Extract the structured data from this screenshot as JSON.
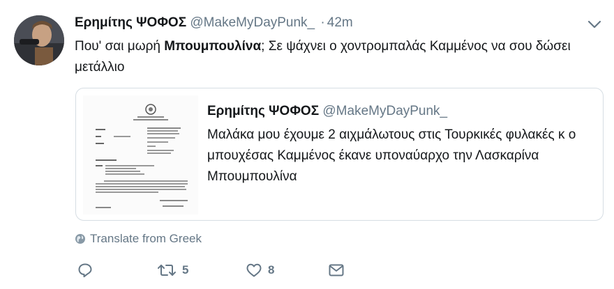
{
  "tweet": {
    "author_name": "Ερημίτης ΨΟΦΟΣ",
    "author_handle": "@MakeMyDayPunk_",
    "separator": "·",
    "time": "42m",
    "text_before": "Που' σαι μωρή ",
    "text_bold": "Μπουμπουλίνα",
    "text_after": "; Σε ψάχνει ο χοντρομπαλάς Καμμένος να σου δώσει μετάλλιο"
  },
  "quoted_tweet": {
    "author_name": "Ερημίτης ΨΟΦΟΣ",
    "author_handle": "@MakeMyDayPunk_",
    "text": "Μαλάκα μου έχουμε 2 αιχμάλωτους στις Τουρκικές φυλακές κ ο μπουχέσας Καμμένος έκανε υποναύαρχο την Λασκαρίνα Μπουμπουλίνα"
  },
  "translate": {
    "label": "Translate from Greek",
    "icon": "globe-icon"
  },
  "actions": {
    "reply_icon": "reply-icon",
    "retweet_icon": "retweet-icon",
    "retweet_count": "5",
    "like_icon": "heart-icon",
    "like_count": "8",
    "dm_icon": "envelope-icon"
  },
  "colors": {
    "text": "#14171a",
    "secondary": "#657786",
    "border": "#d6dde3",
    "background": "#ffffff"
  }
}
